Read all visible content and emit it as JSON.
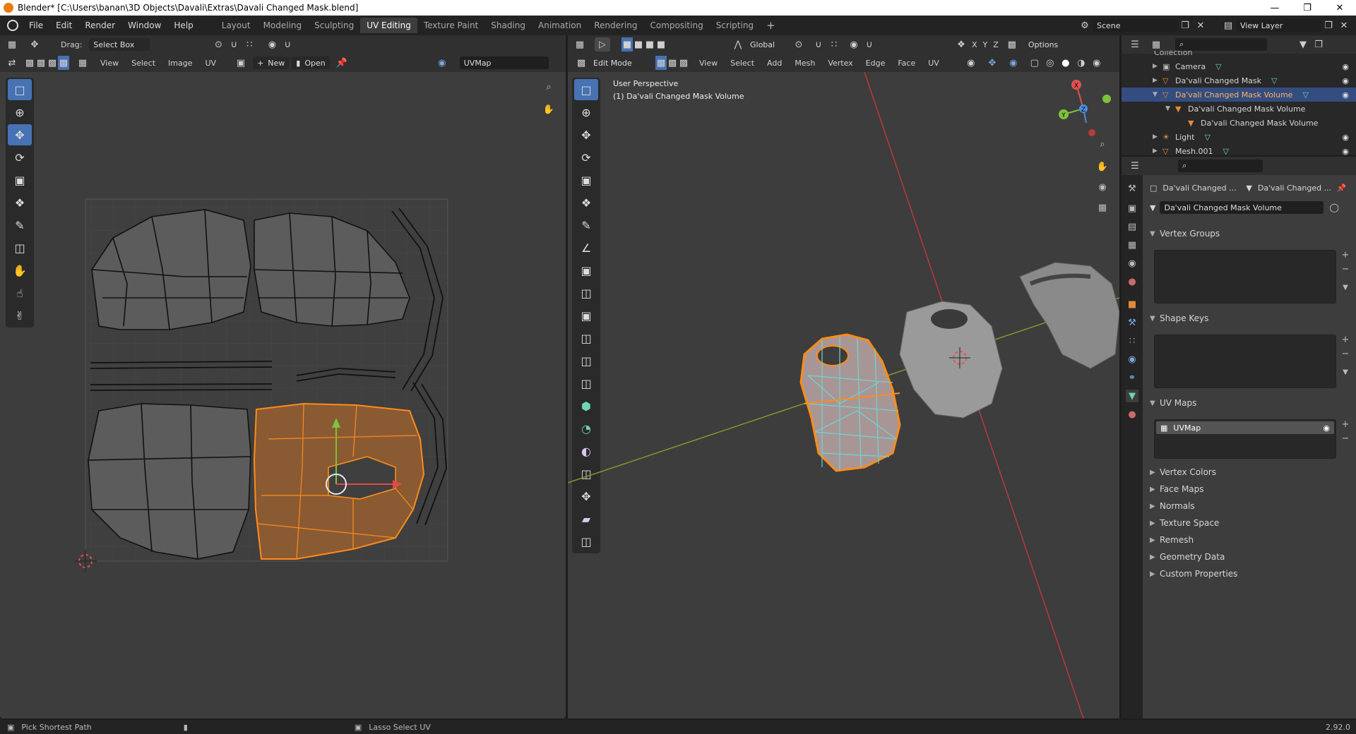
{
  "window": {
    "title": "Blender* [C:\\Users\\banan\\3D Objects\\Davali\\Extras\\Davali Changed Mask.blend]"
  },
  "menu": [
    "File",
    "Edit",
    "Render",
    "Window",
    "Help"
  ],
  "workspaces": [
    "Layout",
    "Modeling",
    "Sculpting",
    "UV Editing",
    "Texture Paint",
    "Shading",
    "Animation",
    "Rendering",
    "Compositing",
    "Scripting"
  ],
  "active_workspace": "UV Editing",
  "scene": {
    "label": "Scene",
    "view_layer": "View Layer"
  },
  "uv_editor": {
    "drag_label": "Drag:",
    "drag_value": "Select Box",
    "menus": [
      "View",
      "Select",
      "Image",
      "UV"
    ],
    "new_label": "New",
    "open_label": "Open",
    "uvmap_field": "UVMap"
  },
  "viewport": {
    "mode": "Edit Mode",
    "menus": [
      "View",
      "Select",
      "Add",
      "Mesh",
      "Vertex",
      "Edge",
      "Face",
      "UV"
    ],
    "orientation": "Global",
    "options_label": "Options",
    "overlay_line1": "User Perspective",
    "overlay_line2": "(1) Da'vali Changed Mask Volume",
    "axes": [
      "X",
      "Y",
      "Z"
    ]
  },
  "outliner": {
    "collection_label": "Collection",
    "items": [
      {
        "label": "Camera",
        "indent": 0,
        "selected": false
      },
      {
        "label": "Da'vali Changed Mask",
        "indent": 0,
        "selected": false
      },
      {
        "label": "Da'vali Changed Mask Volume",
        "indent": 0,
        "selected": true
      },
      {
        "label": "Da'vali Changed Mask Volume",
        "indent": 1,
        "selected": false
      },
      {
        "label": "Da'vali Changed Mask Volume",
        "indent": 2,
        "selected": false
      },
      {
        "label": "Light",
        "indent": 0,
        "selected": false
      },
      {
        "label": "Mesh.001",
        "indent": 0,
        "selected": false
      }
    ]
  },
  "properties": {
    "breadcrumb1": "Da'vali Changed ...",
    "breadcrumb2": "Da'vali Changed ...",
    "mesh_name": "Da'vali Changed Mask Volume",
    "sections_open": [
      "Vertex Groups",
      "Shape Keys",
      "UV Maps"
    ],
    "uvmap_item": "UVMap",
    "sections_closed": [
      "Vertex Colors",
      "Face Maps",
      "Normals",
      "Texture Space",
      "Remesh",
      "Geometry Data",
      "Custom Properties"
    ]
  },
  "status": {
    "left": "Pick Shortest Path",
    "middle": "Lasso Select UV",
    "version": "2.92.0"
  },
  "colors": {
    "accent": "#4772b3",
    "selected_orange": "#ff8c1a",
    "uv_face_fill": "#8a5a33",
    "mesh_cyan": "#6ed6d0"
  }
}
